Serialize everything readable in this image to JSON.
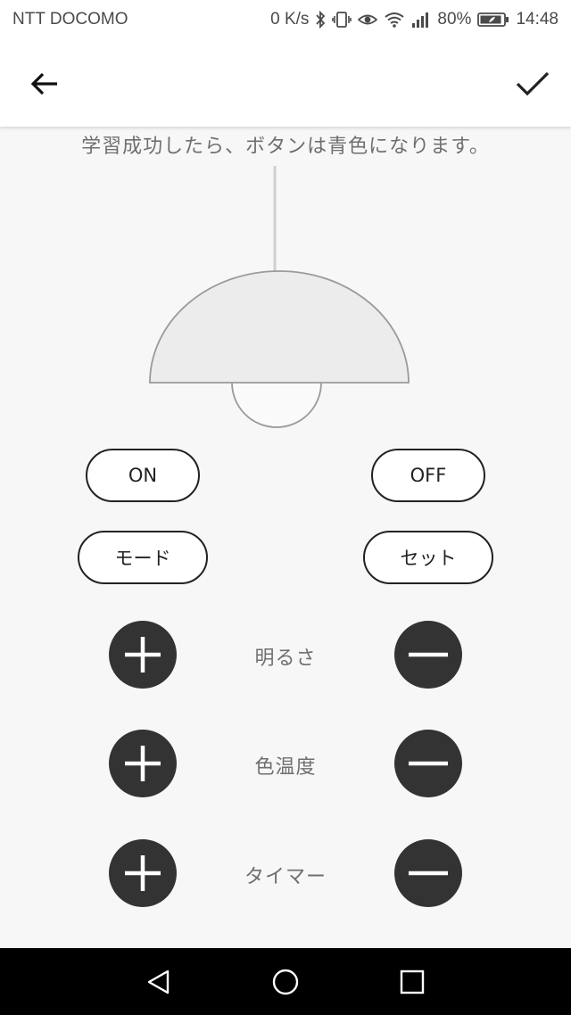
{
  "status_bar": {
    "carrier": "NTT DOCOMO",
    "network_speed": "0 K/s",
    "battery_percent": "80%",
    "time": "14:48",
    "icons": [
      "bluetooth-icon",
      "vibrate-icon",
      "eye-comfort-icon",
      "wifi-icon",
      "signal-icon",
      "battery-icon"
    ]
  },
  "app_bar": {
    "back_icon": "arrow-left-icon",
    "confirm_icon": "checkmark-icon"
  },
  "hint": "学習成功したら、ボタンは青色になります。",
  "lamp_icon": "ceiling-lamp-illustration",
  "buttons": {
    "on": "ON",
    "off": "OFF",
    "mode": "モード",
    "set": "セット"
  },
  "adjust_rows": [
    {
      "label": "明るさ",
      "plus_icon": "plus-icon",
      "minus_icon": "minus-icon"
    },
    {
      "label": "色温度",
      "plus_icon": "plus-icon",
      "minus_icon": "minus-icon"
    },
    {
      "label": "タイマー",
      "plus_icon": "plus-icon",
      "minus_icon": "minus-icon"
    }
  ],
  "nav_bar": {
    "icons": [
      "nav-back-icon",
      "nav-home-icon",
      "nav-recent-icon"
    ]
  },
  "colors": {
    "background": "#f7f7f7",
    "button_dark": "#333333",
    "text_gray": "#6f6f6f",
    "lamp_fill": "#ececec",
    "lamp_stroke": "#9a9a9a"
  }
}
